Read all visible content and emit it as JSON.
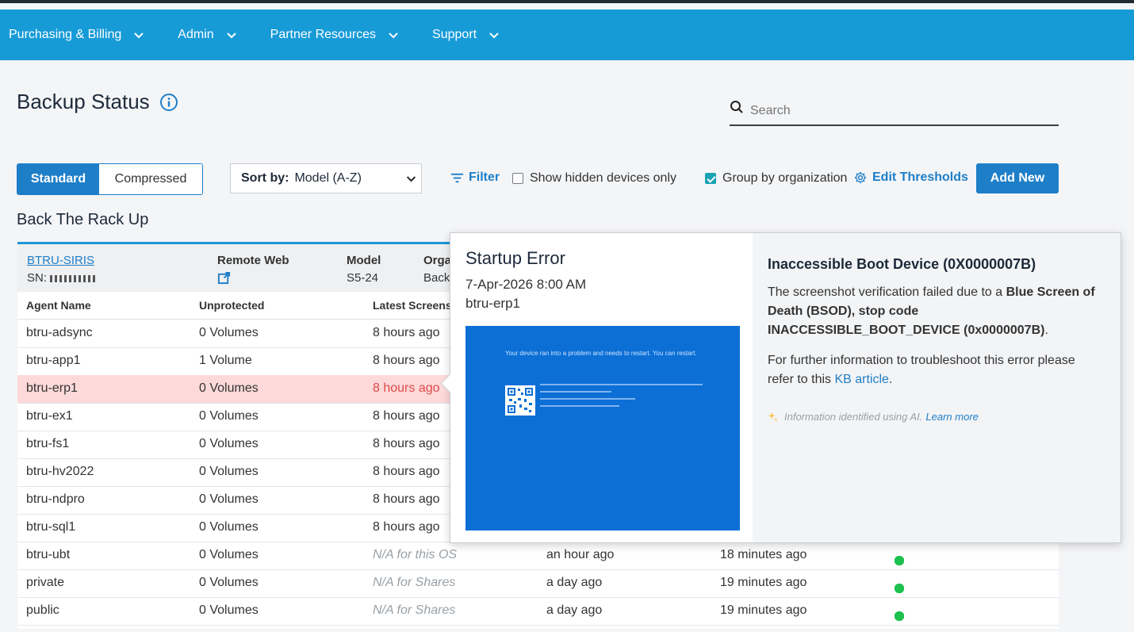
{
  "nav": {
    "items": [
      {
        "label": "Purchasing & Billing"
      },
      {
        "label": "Admin"
      },
      {
        "label": "Partner Resources"
      },
      {
        "label": "Support"
      }
    ]
  },
  "page": {
    "title": "Backup Status"
  },
  "search": {
    "placeholder": "Search",
    "value": ""
  },
  "toolbar": {
    "view_standard": "Standard",
    "view_compressed": "Compressed",
    "sort_label": "Sort by:",
    "sort_value": "Model (A-Z)",
    "filter_label": "Filter",
    "hidden_label": "Show hidden devices only",
    "hidden_checked": false,
    "group_label": "Group by organization",
    "group_checked": true,
    "thresholds_label": "Edit Thresholds",
    "add_label": "Add New"
  },
  "group": {
    "name": "Back The Rack Up"
  },
  "device": {
    "name": "BTRU-SIRIS",
    "sn": "SN: ",
    "remote_web_label": "Remote Web",
    "model_label": "Model",
    "model_value": "S5-24",
    "org_label": "Orga",
    "org_value": "Back"
  },
  "columns": {
    "agent": "Agent Name",
    "unprotected": "Unprotected",
    "latest": "Latest Screens"
  },
  "rows": [
    {
      "agent": "btru-adsync",
      "unprotected": "0 Volumes",
      "latest": "8 hours ago"
    },
    {
      "agent": "btru-app1",
      "unprotected": "1 Volume",
      "latest": "8 hours ago"
    },
    {
      "agent": "btru-erp1",
      "unprotected": "0 Volumes",
      "latest": "8 hours ago"
    },
    {
      "agent": "btru-ex1",
      "unprotected": "0 Volumes",
      "latest": "8 hours ago"
    },
    {
      "agent": "btru-fs1",
      "unprotected": "0 Volumes",
      "latest": "8 hours ago"
    },
    {
      "agent": "btru-hv2022",
      "unprotected": "0 Volumes",
      "latest": "8 hours ago"
    },
    {
      "agent": "btru-ndpro",
      "unprotected": "0 Volumes",
      "latest": "8 hours ago"
    },
    {
      "agent": "btru-sql1",
      "unprotected": "0 Volumes",
      "latest": "8 hours ago"
    },
    {
      "agent": "btru-ubt",
      "unprotected": "0 Volumes",
      "latest": "N/A for this OS",
      "col4": "an hour ago",
      "col5": "18 minutes ago",
      "history": 10
    },
    {
      "agent": "private",
      "unprotected": "0 Volumes",
      "latest": "N/A for Shares",
      "col4": "a day ago",
      "col5": "19 minutes ago",
      "history": 10
    },
    {
      "agent": "public",
      "unprotected": "0 Volumes",
      "latest": "N/A for Shares",
      "col4": "a day ago",
      "col5": "19 minutes ago",
      "history": 10
    }
  ],
  "popup": {
    "title": "Startup Error",
    "date": "7-Apr-2026 8:00 AM",
    "host": "btru-erp1",
    "bsod_text": "Your device ran into a problem and needs to restart. You can restart.",
    "error_title": "Inaccessible Boot Device (0X0000007B)",
    "desc_pre": "The screenshot verification failed due to a ",
    "desc_bold1": "Blue Screen of Death (BSOD), stop code INACCESSIBLE_BOOT_DEVICE (0x0000007B)",
    "desc_post": ".",
    "more_pre": "For further information to troubleshoot this error please refer to this ",
    "kb_link": "KB article",
    "more_post": ".",
    "ai_note": "Information identified using AI.",
    "learn_more": "Learn more"
  },
  "colors": {
    "nav_bg": "#179bd7",
    "accent": "#1e7ec8",
    "selected_row": "#fdd9d9",
    "status_ok": "#1cc14e",
    "bsod_blue": "#0b6fd6"
  }
}
